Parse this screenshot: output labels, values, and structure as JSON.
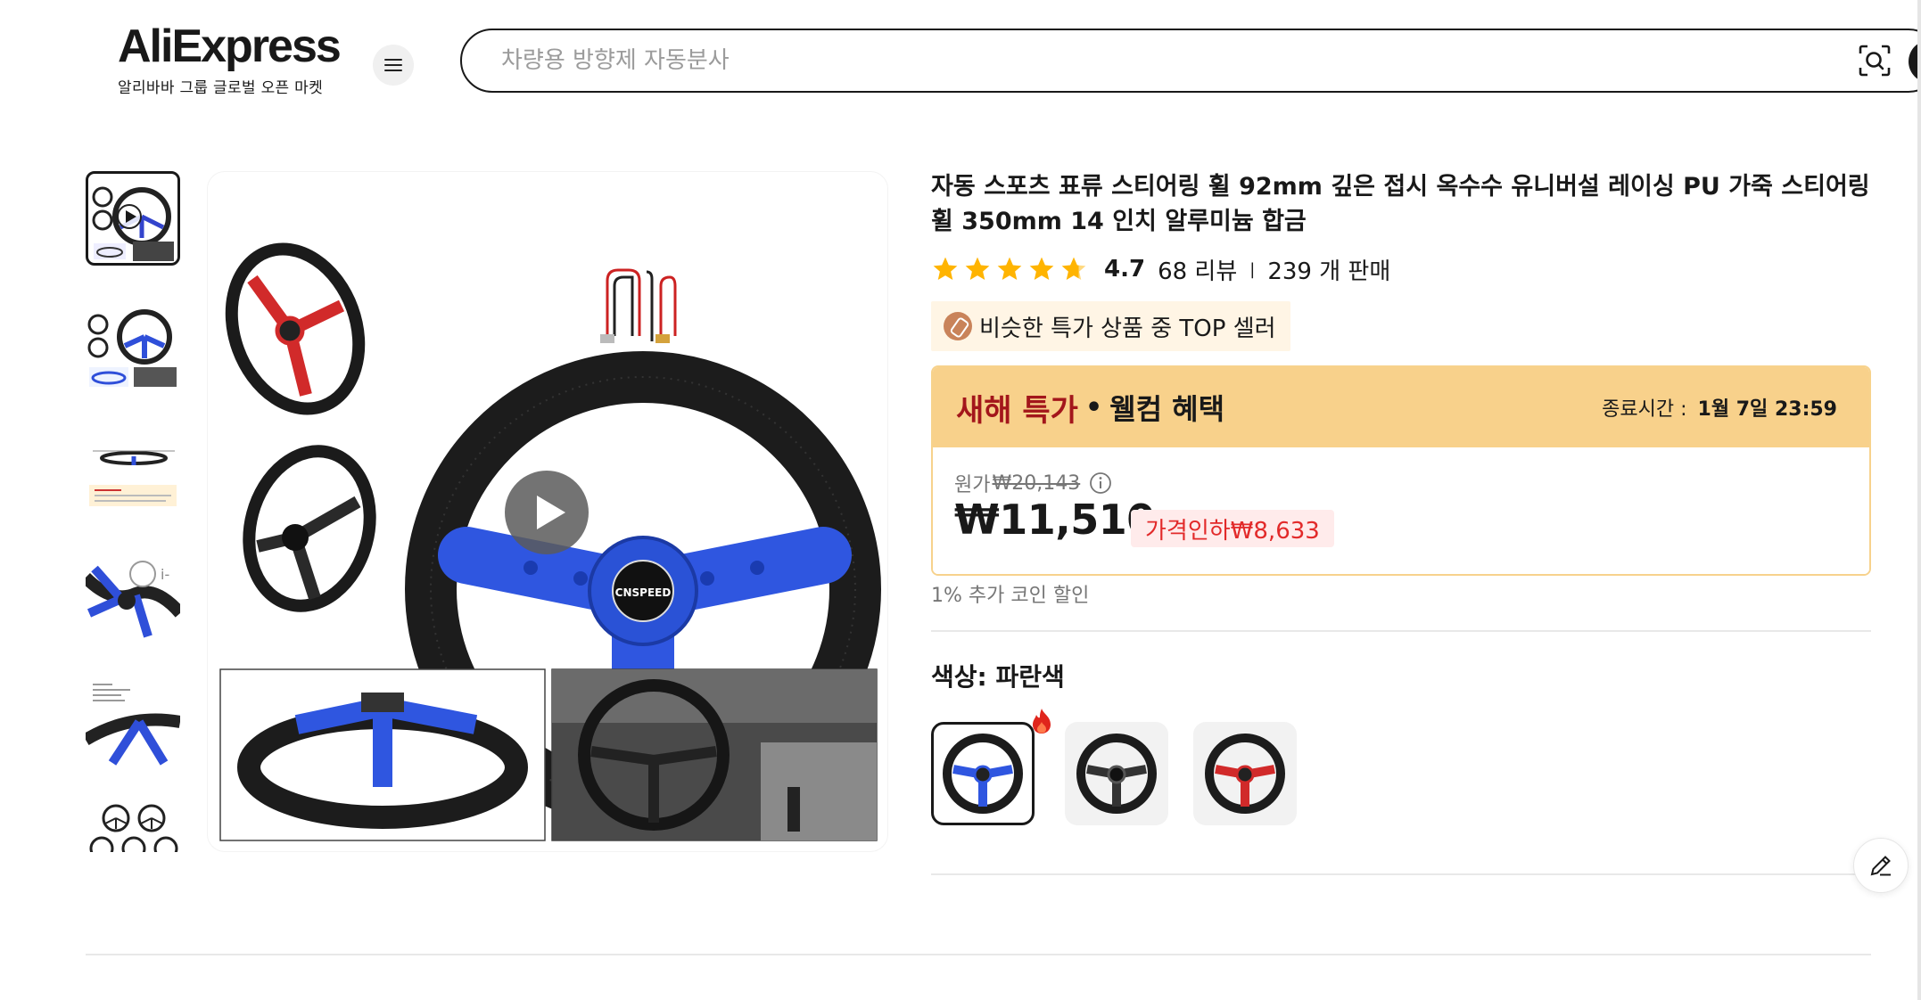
{
  "header": {
    "logo_text": "AliExpress",
    "logo_subtitle": "알리바바 그룹 글로벌 오픈 마켓",
    "search_placeholder": "차량용 방향제 자동분사"
  },
  "product": {
    "title": "자동 스포츠 표류 스티어링 휠 92mm 깊은 접시 옥수수 유니버설 레이싱 PU 가죽 스티어링 휠 350mm 14 인치 알루미늄 합금",
    "rating": "4.7",
    "reviews": "68 리뷰",
    "sold": "239 개 판매",
    "star_count": 5,
    "badge": "비슷한 특가 상품 중 TOP 셀러"
  },
  "deal": {
    "name": "새해 특가",
    "dot": "•",
    "sub": "웰컴 혜택",
    "end_label": "종료시간 :",
    "end_time": "1월 7일 23:59",
    "original_label": "원가",
    "original_price": "₩20,143",
    "price": "₩11,510",
    "discount": "가격인하₩8,633"
  },
  "coin_text": "1% 추가 코인 할인",
  "color": {
    "label": "색상: 파란색",
    "options": [
      "blue",
      "black",
      "red"
    ],
    "selected": "blue"
  },
  "colors": {
    "accent_red": "#a3161b",
    "deal_header": "#f8d18b",
    "discount_text": "#e22a2a",
    "star": "#ffb400"
  }
}
